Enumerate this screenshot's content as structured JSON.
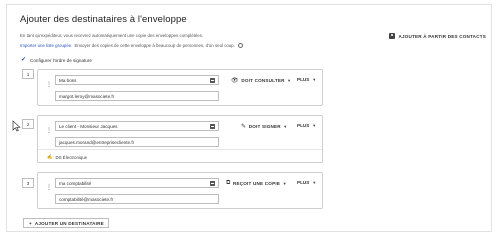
{
  "page": {
    "title": "Ajouter des destinataires à l'enveloppe",
    "description_line1": "En tant qu'expéditeur, vous recevrez automatiquement une copie des enveloppes complétées.",
    "import_link": "Importer une liste groupée.",
    "description_line2": " Envoyer des copies de cette enveloppe à beaucoup de personnes, d'un seul coup.",
    "info_icon": "i",
    "add_from_contacts": "AJOUTER À PARTIR DES CONTACTS",
    "signing_order_label": "Configurer l'ordre de signature",
    "add_recipient": "AJOUTER UN DESTINATAIRE"
  },
  "recipients": [
    {
      "order": "1",
      "name": "Ma boss",
      "email": "margot.leroy@masociete.fr",
      "role": "DOIT CONSULTER",
      "more": "PLUS"
    },
    {
      "order": "2",
      "name": "Le client - Monsieur Jacques",
      "email": "jacques.morand@entreprisecliente.fr",
      "role": "DOIT SIGNER",
      "more": "PLUS",
      "signature_type": "DS Électronique"
    },
    {
      "order": "3",
      "name": "ma comptabilité",
      "email": "comptabilité@masociete.fr",
      "role": "REÇOIT UNE COPIE",
      "more": "PLUS"
    }
  ],
  "icons": {
    "role_consult": "👁",
    "role_sign": "✎",
    "role_copy": "⧉",
    "caret": "▼",
    "drag": "⋮",
    "check": "✔",
    "add_person": "+",
    "signature_pen": "✍"
  },
  "colors": {
    "accent_blue": "#2a55c9",
    "border": "#bdbdbd"
  }
}
